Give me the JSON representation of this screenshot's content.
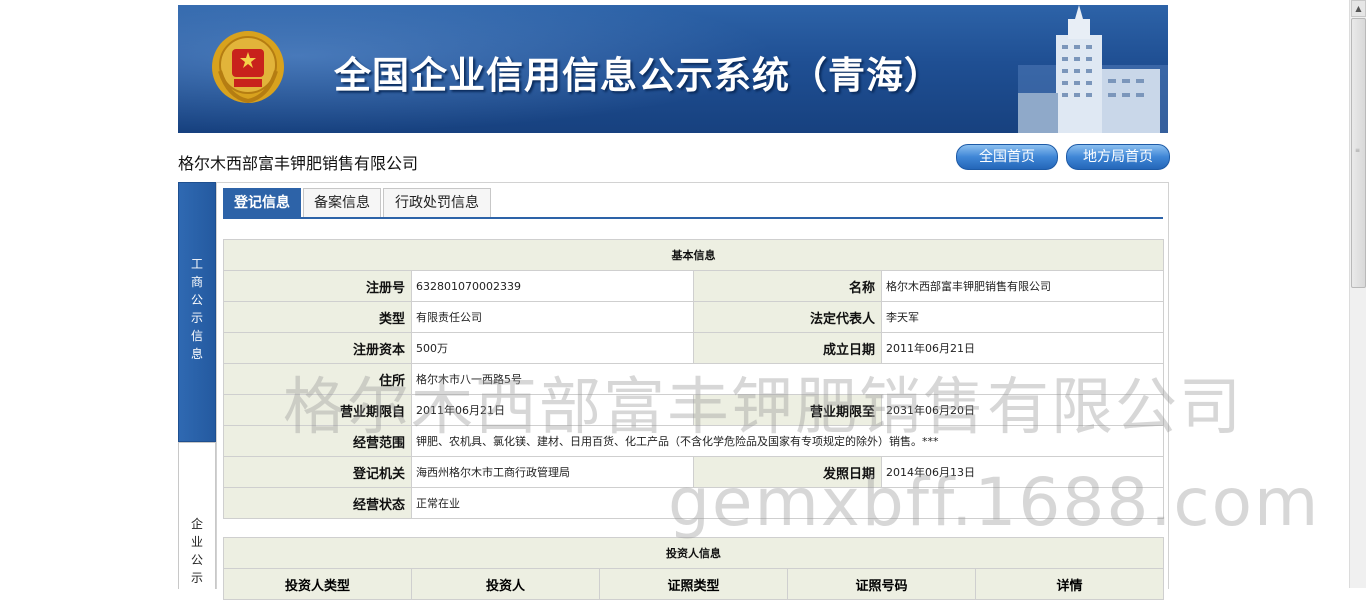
{
  "header": {
    "title": "全国企业信用信息公示系统（青海）",
    "emblem_icon": "national-emblem-icon",
    "building_icon": "building-illustration",
    "colors": {
      "banner": "#1f4f93",
      "accent": "#2d63a8",
      "label_bg": "#edefe2"
    }
  },
  "company_name": "格尔木西部富丰钾肥销售有限公司",
  "nav": {
    "national_home": "全国首页",
    "local_home": "地方局首页"
  },
  "sidebar": {
    "item1": [
      "工",
      "商",
      "公",
      "示",
      "信",
      "息"
    ],
    "item2": [
      "企",
      "业",
      "公",
      "示"
    ]
  },
  "tabs": [
    "登记信息",
    "备案信息",
    "行政处罚信息"
  ],
  "basic_info": {
    "title": "基本信息",
    "rows": [
      {
        "l1": "注册号",
        "v1": "632801070002339",
        "l2": "名称",
        "v2": "格尔木西部富丰钾肥销售有限公司"
      },
      {
        "l1": "类型",
        "v1": "有限责任公司",
        "l2": "法定代表人",
        "v2": "李天军"
      },
      {
        "l1": "注册资本",
        "v1": "500万",
        "l2": "成立日期",
        "v2": "2011年06月21日"
      },
      {
        "l1": "住所",
        "v1": "格尔木市八一西路5号"
      },
      {
        "l1": "营业期限自",
        "v1": "2011年06月21日",
        "l2": "营业期限至",
        "v2": "2031年06月20日"
      },
      {
        "l1": "经营范围",
        "v1": "钾肥、农机具、氯化镁、建材、日用百货、化工产品（不含化学危险品及国家有专项规定的除外）销售。***"
      },
      {
        "l1": "登记机关",
        "v1": "海西州格尔木市工商行政管理局",
        "l2": "发照日期",
        "v2": "2014年06月13日"
      },
      {
        "l1": "经营状态",
        "v1": "正常在业"
      }
    ]
  },
  "investor_info": {
    "title": "投资人信息",
    "columns": [
      "投资人类型",
      "投资人",
      "证照类型",
      "证照号码",
      "详情"
    ]
  },
  "watermark": {
    "line1": "格尔木西部富丰钾肥销售有限公司",
    "line2": "gemxbff.1688.com"
  }
}
